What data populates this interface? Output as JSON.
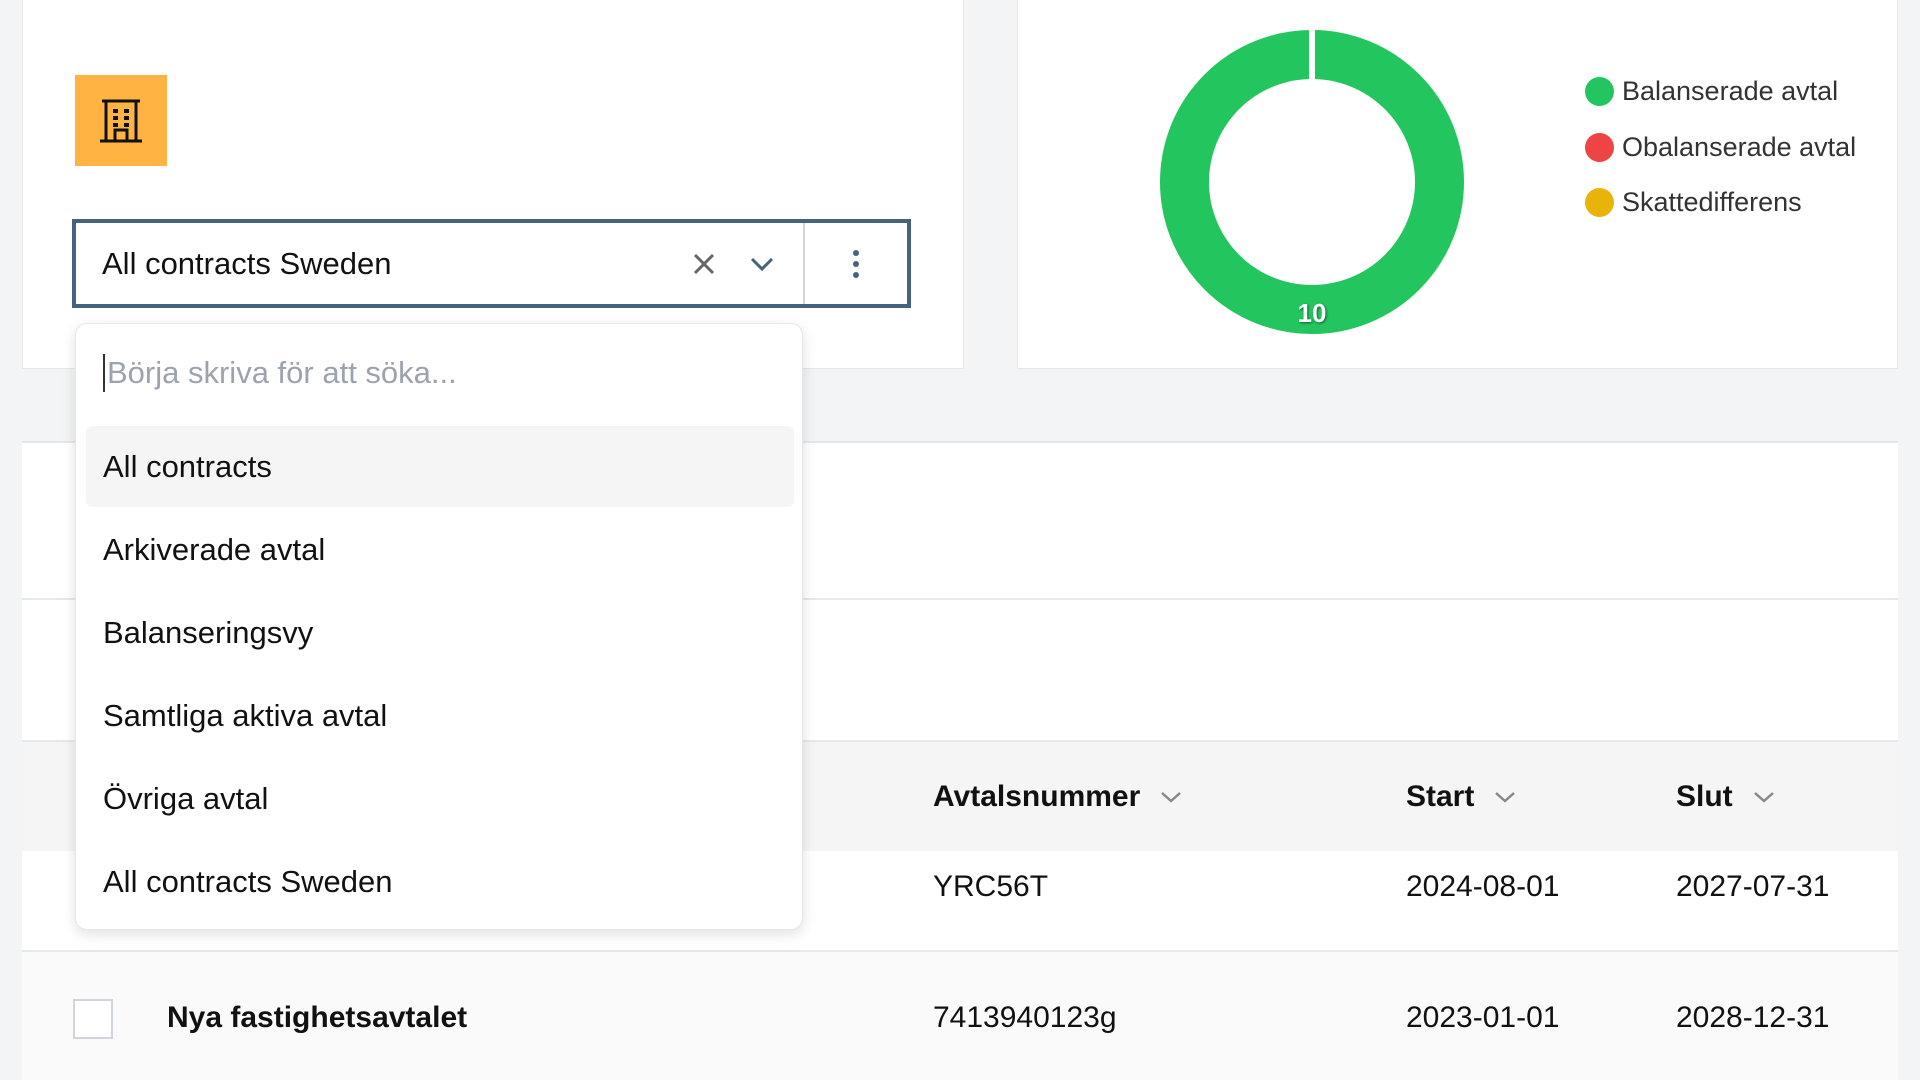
{
  "selector": {
    "value": "All contracts Sweden"
  },
  "dropdown": {
    "search_placeholder": "Börja skriva för att söka...",
    "options": [
      "All contracts",
      "Arkiverade avtal",
      "Balanseringsvy",
      "Samtliga aktiva avtal",
      "Övriga avtal",
      "All contracts Sweden"
    ],
    "highlighted": "All contracts"
  },
  "chart_data": {
    "type": "pie",
    "donut": true,
    "categories": [
      "Balanserade avtal",
      "Obalanserade avtal",
      "Skattedifferens"
    ],
    "values": [
      10,
      0,
      0
    ],
    "colors": [
      "#22c55e",
      "#ef4444",
      "#eab308"
    ],
    "data_labels": [
      "10"
    ],
    "legend_placement": "right"
  },
  "table": {
    "columns": [
      "Avtalsnummer",
      "Start",
      "Slut"
    ],
    "rows": [
      {
        "name": "",
        "number": "YRC56T",
        "start": "2024-08-01",
        "end": "2027-07-31"
      },
      {
        "name": "Nya fastighetsavtalet",
        "number": "7413940123g",
        "start": "2023-01-01",
        "end": "2028-12-31"
      }
    ]
  }
}
